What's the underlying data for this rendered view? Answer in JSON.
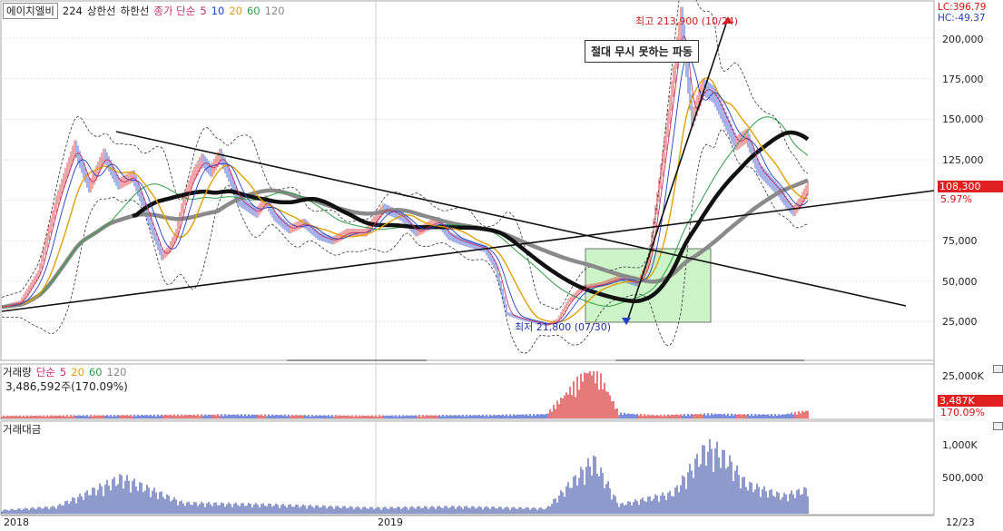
{
  "price_legend": {
    "stock_name": "에이치엘비",
    "period": "224",
    "upper_limit": "상한선",
    "lower_limit": "하한선",
    "close_ma": "종가 단순",
    "ma": [
      "5",
      "10",
      "20",
      "60",
      "120"
    ]
  },
  "price_readouts": {
    "lc": "LC:396.79",
    "hc": "HC:-49.37",
    "current_price": "108,300",
    "change_pct": "5.97%"
  },
  "annotations": {
    "high": "최고 213,900 (10/24)",
    "low": "최저 21,800 (07/30)",
    "callout": "절대 무시 못하는 파동"
  },
  "volume_panel": {
    "title": "거래량",
    "ma_label": "단순",
    "ma": [
      "5",
      "20",
      "60",
      "120"
    ],
    "current_value": "3,486,592주(170.09%)",
    "badge_value": "3,487K",
    "badge_pct": "170.09%"
  },
  "amount_panel": {
    "title": "거래대금"
  },
  "x_axis": {
    "labels": [
      "2018",
      "2019"
    ],
    "date": "12/23"
  },
  "colors": {
    "ma5": "#c0306a",
    "ma10": "#1f3fbf",
    "ma20": "#e0a000",
    "ma60": "#2e9e46",
    "ma120": "#888888",
    "up": "#d42020",
    "down": "#2040c8",
    "box": "#b8f0b0",
    "badge": "#e02020"
  },
  "chart_data": [
    {
      "type": "line",
      "title": "",
      "ylim": [
        0,
        225000
      ],
      "y_ticks": [
        "25,000",
        "50,000",
        "75,000",
        "100,000",
        "125,000",
        "150,000",
        "175,000",
        "200,000"
      ],
      "series": [
        {
          "x": [
            0,
            10,
            20,
            30,
            40,
            48,
            56,
            64,
            72,
            80,
            88,
            92,
            96,
            100,
            105,
            110,
            115,
            120,
            125,
            130,
            135,
            140,
            145,
            150,
            158,
            166,
            174,
            182,
            190,
            200,
            210,
            220,
            228,
            236,
            240,
            246,
            252,
            260,
            266,
            272,
            278,
            285,
            292,
            300,
            306,
            312,
            320,
            330,
            340,
            350,
            356,
            362,
            368,
            374,
            380,
            386,
            392,
            398,
            404,
            410,
            416,
            420,
            424,
            428,
            432,
            436,
            440,
            444
          ],
          "y": [
            34000,
            37000,
            55000,
            100000,
            133000,
            108000,
            128000,
            110000,
            115000,
            90000,
            65000,
            70000,
            80000,
            100000,
            115000,
            125000,
            118000,
            128000,
            115000,
            100000,
            96000,
            92000,
            100000,
            90000,
            82000,
            86000,
            78000,
            75000,
            80000,
            80000,
            95000,
            90000,
            80000,
            85000,
            87000,
            78000,
            75000,
            72000,
            70000,
            58000,
            30000,
            27000,
            25000,
            23000,
            26000,
            38000,
            46000,
            48000,
            52000,
            48000,
            62000,
            110000,
            160000,
            213000,
            150000,
            170000,
            165000,
            150000,
            135000,
            140000,
            120000,
            115000,
            110000,
            105000,
            98000,
            93000,
            100000,
            108300
          ]
        }
      ]
    },
    {
      "type": "bar",
      "title": "",
      "y_ticks": [
        "25,000K"
      ],
      "x": [
        0,
        60,
        130,
        200,
        270,
        300,
        326,
        340,
        360,
        390,
        400,
        430,
        443
      ],
      "values": [
        1200,
        1500,
        1800,
        1300,
        1600,
        2000,
        25000,
        2500,
        1500,
        2200,
        2000,
        1800,
        3487
      ]
    },
    {
      "type": "bar",
      "title": "",
      "y_ticks": [
        "500,000",
        "1,000K"
      ],
      "x": [
        0,
        30,
        66,
        100,
        150,
        205,
        250,
        300,
        326,
        340,
        370,
        388,
        394,
        400,
        410,
        430,
        443
      ],
      "values": [
        60000,
        120000,
        600000,
        180000,
        150000,
        100000,
        120000,
        90000,
        900000,
        150000,
        350000,
        1100000,
        1050000,
        900000,
        500000,
        300000,
        400000
      ]
    }
  ]
}
